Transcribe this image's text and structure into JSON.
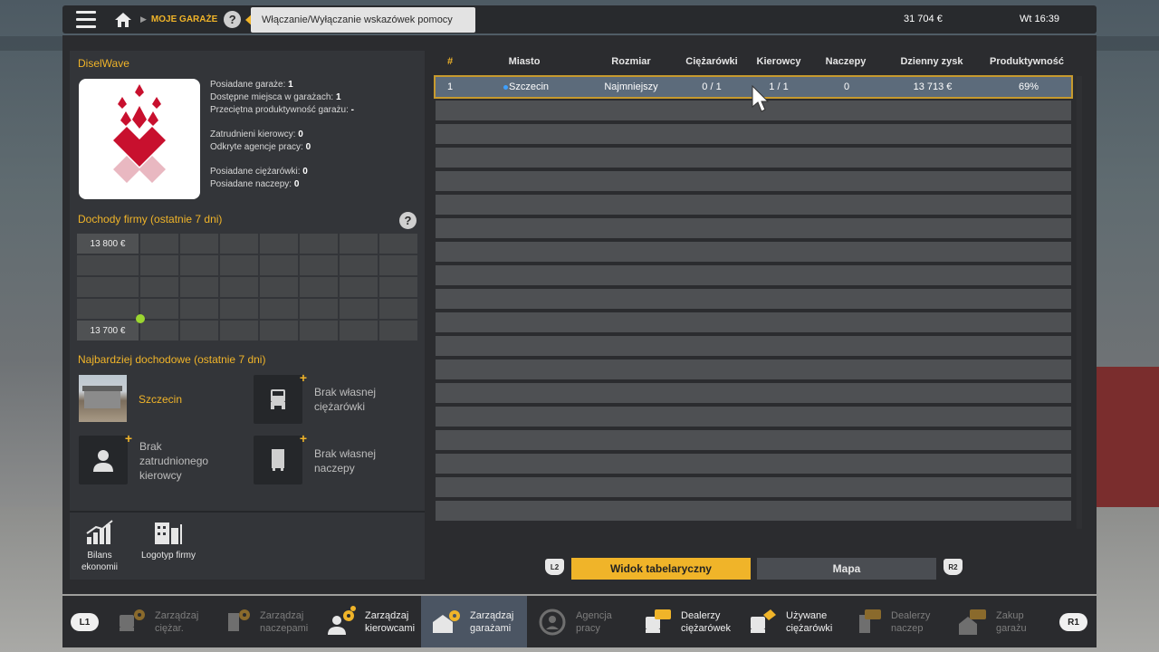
{
  "topbar": {
    "section_title": "MOJE GARAŻE",
    "help_glyph": "?",
    "tooltip": "Włączanie/Wyłączanie wskazówek pomocy",
    "money": "31 704 €",
    "clock": "Wt 16:39"
  },
  "company": {
    "name": "DiselWave",
    "stats": [
      {
        "label": "Posiadane garaże: ",
        "value": "1"
      },
      {
        "label": "Dostępne miejsca w garażach: ",
        "value": "1"
      },
      {
        "label": "Przeciętna produktywność garażu: ",
        "value": "-"
      },
      {
        "label": "Zatrudnieni kierowcy: ",
        "value": "0"
      },
      {
        "label": "Odkryte agencje pracy: ",
        "value": "0"
      },
      {
        "label": "Posiadane ciężarówki: ",
        "value": "0"
      },
      {
        "label": "Posiadane naczepy: ",
        "value": "0"
      }
    ]
  },
  "income": {
    "title": "Dochody firmy (ostatnie 7 dni)",
    "y_max_label": "13 800 €",
    "y_min_label": "13 700 €"
  },
  "top_earning": {
    "title": "Najbardziej dochodowe (ostatnie 7 dni)",
    "garage": "Szczecin",
    "truck": "Brak własnej ciężarówki",
    "driver": "Brak zatrudnionego kierowcy",
    "trailer": "Brak własnej naczepy"
  },
  "bottom_buttons": {
    "economy": "Bilans ekonomii",
    "logo": "Logotyp firmy"
  },
  "table": {
    "headers": [
      "#",
      "Miasto",
      "Rozmiar",
      "Ciężarówki",
      "Kierowcy",
      "Naczepy",
      "Dzienny zysk",
      "Produktywność"
    ],
    "rows": [
      [
        "1",
        "Szczecin",
        "Najmniejszy",
        "0 / 1",
        "1 / 1",
        "0",
        "13 713 €",
        "69%"
      ]
    ]
  },
  "view_toggle": {
    "left_pad": "L2",
    "right_pad": "R2",
    "table_view": "Widok tabelaryczny",
    "map_view": "Mapa"
  },
  "nav": {
    "left_pill": "L1",
    "right_pill": "R1",
    "items": [
      {
        "line1": "Zarządzaj",
        "line2": "ciężar."
      },
      {
        "line1": "Zarządzaj",
        "line2": "naczepami"
      },
      {
        "line1": "Zarządzaj",
        "line2": "kierowcami"
      },
      {
        "line1": "Zarządzaj",
        "line2": "garażami"
      },
      {
        "line1": "Agencja",
        "line2": "pracy"
      },
      {
        "line1": "Dealerzy",
        "line2": "ciężarówek"
      },
      {
        "line1": "Używane",
        "line2": "ciężarówki"
      },
      {
        "line1": "Dealerzy",
        "line2": "naczep"
      },
      {
        "line1": "Zakup",
        "line2": "garażu"
      }
    ]
  },
  "colors": {
    "accent": "#f0b429",
    "selected_row": "#5c6b7b",
    "chart_dot": "#9bd630"
  },
  "chart_data": {
    "type": "line",
    "title": "Dochody firmy (ostatnie 7 dni)",
    "ylim": [
      13700,
      13800
    ],
    "series": [
      {
        "values": [
          13713
        ]
      }
    ],
    "grid": true
  }
}
